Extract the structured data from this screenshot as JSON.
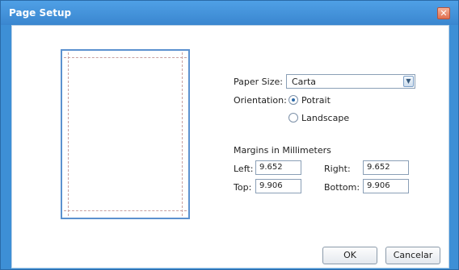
{
  "window": {
    "title": "Page Setup",
    "close_glyph": "✕"
  },
  "paper_size": {
    "label": "Paper Size:",
    "value": "Carta",
    "dropdown_glyph": "▼"
  },
  "orientation": {
    "label": "Orientation:",
    "options": [
      {
        "label": "Potrait",
        "selected": true
      },
      {
        "label": "Landscape",
        "selected": false
      }
    ]
  },
  "margins": {
    "heading": "Margins in Millimeters",
    "left": {
      "label": "Left:",
      "value": "9.652"
    },
    "right": {
      "label": "Right:",
      "value": "9.652"
    },
    "top": {
      "label": "Top:",
      "value": "9.906"
    },
    "bottom": {
      "label": "Bottom:",
      "value": "9.906"
    }
  },
  "buttons": {
    "ok": "OK",
    "cancel": "Cancelar"
  }
}
